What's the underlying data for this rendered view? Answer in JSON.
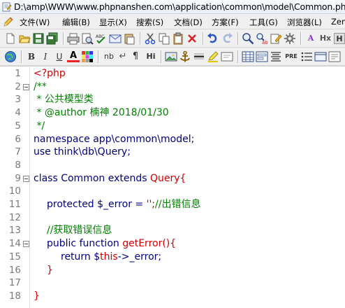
{
  "window": {
    "title": "D:\\amp\\WWW\\www.phpnanshen.com\\application\\common\\model\\Common.php"
  },
  "menu": {
    "items": [
      {
        "label": "文件(W)"
      },
      {
        "label": "编辑(B)"
      },
      {
        "label": "显示(X)"
      },
      {
        "label": "搜索(S)"
      },
      {
        "label": "文档(D)"
      },
      {
        "label": "方案(F)"
      },
      {
        "label": "工具(G)"
      },
      {
        "label": "浏览器(L)"
      },
      {
        "label": "Zen"
      }
    ]
  },
  "toolbar2": {
    "nb_label": "nb",
    "hi_label": "Hi",
    "pre_label": "PRE",
    "hx_label": "Hx"
  },
  "editor": {
    "lines": [
      {
        "n": "1",
        "t": "<?php"
      },
      {
        "n": "2",
        "t": "/**"
      },
      {
        "n": "3",
        "t": " * 公共模型类"
      },
      {
        "n": "4",
        "t": " * @author 楠神 2018/01/30"
      },
      {
        "n": "5",
        "t": " */"
      },
      {
        "n": "6",
        "kw": "namespace",
        "rest": " app\\common\\model;"
      },
      {
        "n": "7",
        "kw": "use",
        "rest": " think\\db\\Query;"
      },
      {
        "n": "8",
        "t": ""
      },
      {
        "n": "9",
        "kw": "class",
        "a": " Common ",
        "kw2": "extends",
        "b": " Query{"
      },
      {
        "n": "10",
        "t": ""
      },
      {
        "n": "11",
        "kw": "protected",
        "a": " $_error = ",
        "b": "'';",
        "c": "//出错信息"
      },
      {
        "n": "12",
        "t": ""
      },
      {
        "n": "13",
        "t": "//获取错误信息"
      },
      {
        "n": "14",
        "kw": "public",
        "a": " function ",
        "b": "getError(){"
      },
      {
        "n": "15",
        "kw": "return",
        "a": " $",
        "b": "this",
        "c": "->_error;"
      },
      {
        "n": "16",
        "t": "}"
      },
      {
        "n": "17",
        "t": ""
      },
      {
        "n": "18",
        "t": "}"
      }
    ]
  }
}
